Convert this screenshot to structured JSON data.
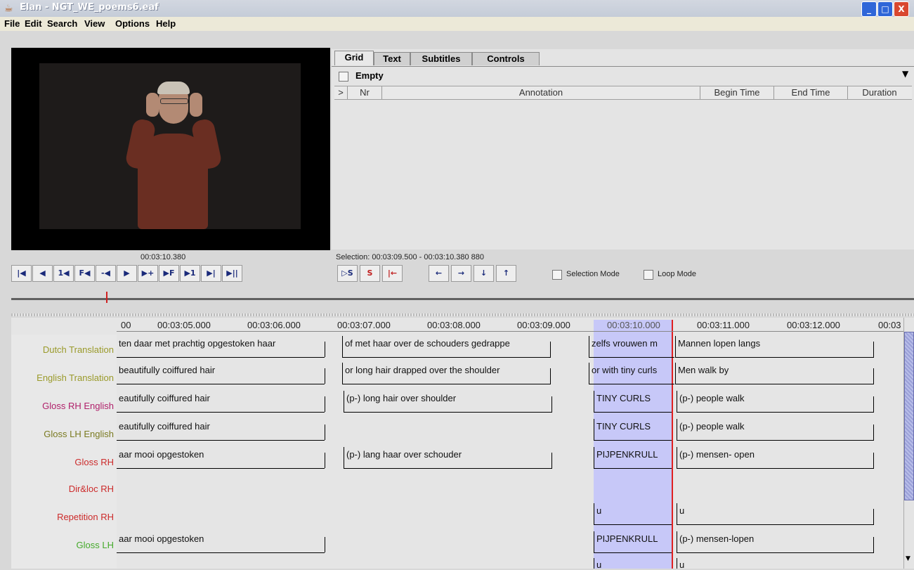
{
  "window": {
    "title": "Elan - NGT_WE_poems6.eaf",
    "controls": {
      "minimize": "_",
      "maximize": "□",
      "close": "X"
    }
  },
  "menu": [
    "File",
    "Edit",
    "Search",
    "View",
    "Options",
    "Help"
  ],
  "video": {
    "time": "00:03:10.380"
  },
  "tabs": [
    "Grid",
    "Text",
    "Subtitles",
    "Controls"
  ],
  "grid": {
    "tier_select": "Empty",
    "columns": [
      ">",
      "Nr",
      "Annotation",
      "Begin Time",
      "End Time",
      "Duration"
    ]
  },
  "selection_info": "Selection: 00:03:09.500 - 00:03:10.380  880",
  "player_buttons": [
    "|◀",
    "◀",
    "1◀",
    "F◀",
    "-◀",
    "▶",
    "▶+",
    "▶F",
    "▶1",
    "▶|",
    "▶||"
  ],
  "selection_buttons": [
    "▷S",
    "S",
    "|←",
    "←",
    "→",
    "↓",
    "↑"
  ],
  "modes": {
    "selection": "Selection Mode",
    "loop": "Loop Mode"
  },
  "timeline": {
    "ticks": [
      "00",
      "00:03:05.000",
      "00:03:06.000",
      "00:03:07.000",
      "00:03:08.000",
      "00:03:09.000",
      "00:03:10.000",
      "00:03:11.000",
      "00:03:12.000",
      "00:03"
    ],
    "tiers": [
      {
        "label": "Dutch Translation",
        "color": "#9a9a2a",
        "annotations": [
          "ten daar met prachtig opgestoken haar",
          "of met haar over de schouders gedrappe",
          "zelfs vrouwen m",
          "Mannen lopen langs"
        ]
      },
      {
        "label": "English Translation",
        "color": "#9a9a2a",
        "annotations": [
          "beautifully coiffured hair",
          "or long hair drapped over the shoulder",
          "or with tiny curls",
          "Men walk by"
        ]
      },
      {
        "label": "Gloss RH English",
        "color": "#b0206a",
        "annotations": [
          "eautifully coiffured hair",
          "(p-) long hair over shoulder",
          "TINY CURLS",
          "(p-) people walk"
        ]
      },
      {
        "label": "Gloss LH English",
        "color": "#7a7a20",
        "annotations": [
          "eautifully coiffured hair",
          "",
          "TINY CURLS",
          "(p-) people walk"
        ]
      },
      {
        "label": "Gloss RH",
        "color": "#cc2a2a",
        "annotations": [
          "aar mooi opgestoken",
          "(p-) lang haar over schouder",
          "PIJPENKRULL",
          "(p-) mensen- open"
        ]
      },
      {
        "label": "Dir&loc RH",
        "color": "#cc2a2a",
        "annotations": []
      },
      {
        "label": "Repetition RH",
        "color": "#cc2a2a",
        "annotations": [
          "",
          "",
          "u",
          "u"
        ]
      },
      {
        "label": "Gloss LH",
        "color": "#44aa2a",
        "annotations": [
          "aar mooi opgestoken",
          "",
          "PIJPENKRULL",
          "(p-) mensen-lopen"
        ]
      },
      {
        "label": "",
        "color": "#cc2a2a",
        "annotations": [
          "",
          "",
          "u",
          "u"
        ]
      }
    ]
  }
}
